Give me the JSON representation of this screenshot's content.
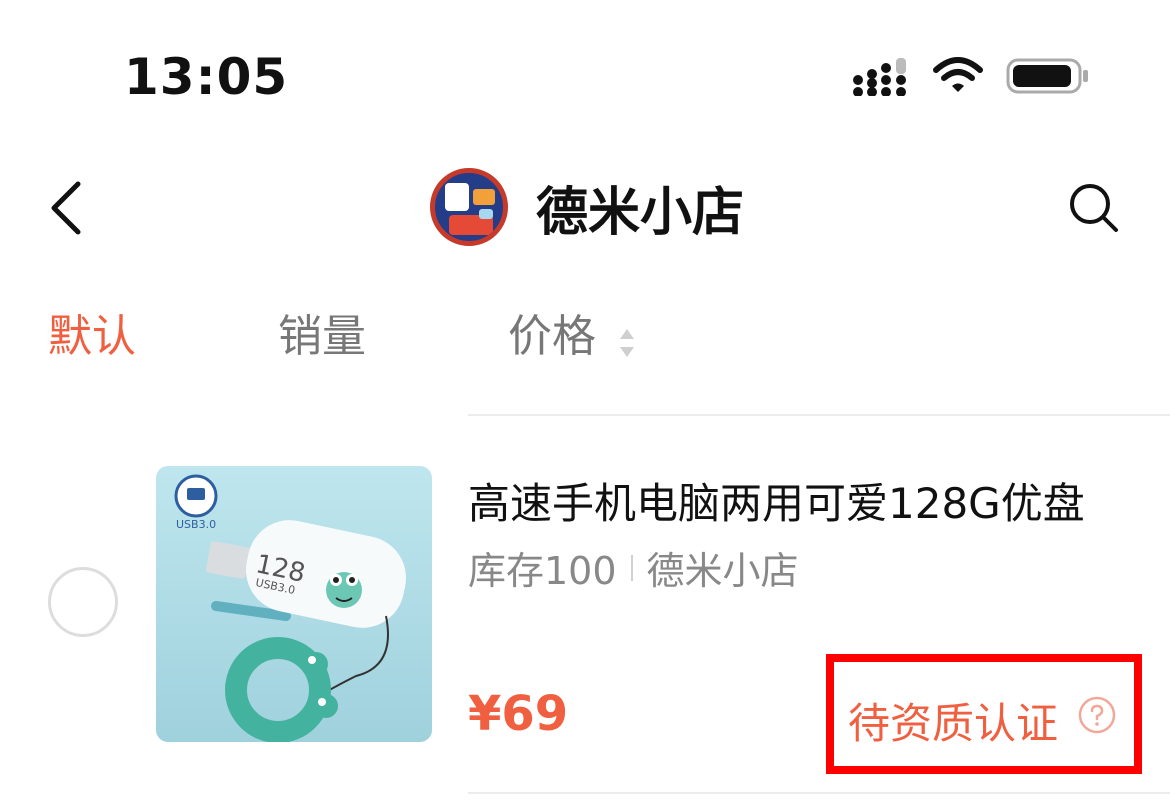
{
  "status_bar": {
    "time": "13:05",
    "icons": [
      "cellular-signal-icon",
      "wifi-icon",
      "battery-icon"
    ]
  },
  "nav": {
    "shop_name": "德米小店",
    "icons": [
      "back-chevron-icon",
      "shop-logo",
      "search-icon"
    ]
  },
  "sort_tabs": [
    {
      "label": "默认",
      "active": true
    },
    {
      "label": "销量",
      "active": false
    },
    {
      "label": "价格",
      "active": false,
      "icon": "sort-arrows-icon"
    }
  ],
  "product": {
    "title": "高速手机电脑两用可爱128G优盘",
    "stock": "库存100",
    "shop": "德米小店",
    "price": "¥69",
    "status": "待资质认证",
    "status_icon": "help-circle-icon",
    "thumb_text": {
      "usb_label": "USB3.0",
      "capacity": "128",
      "drive_label": "USB3.0"
    }
  },
  "colors": {
    "accent": "#f06040",
    "highlight_box": "#ff0000",
    "divider": "#ececec",
    "muted_text": "#888888"
  }
}
